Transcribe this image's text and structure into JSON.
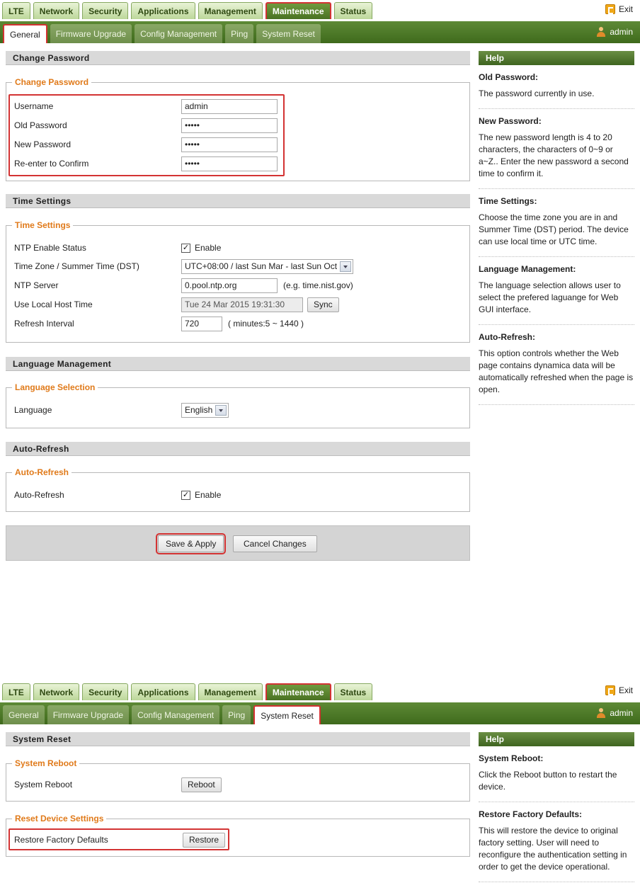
{
  "top_tabs": [
    "LTE",
    "Network",
    "Security",
    "Applications",
    "Management",
    "Maintenance",
    "Status"
  ],
  "exit_label": "Exit",
  "sub_tabs": [
    "General",
    "Firmware Upgrade",
    "Config Management",
    "Ping",
    "System Reset"
  ],
  "user_label": "admin",
  "general": {
    "change_password": {
      "header": "Change Password",
      "legend": "Change Password",
      "username_label": "Username",
      "username_value": "admin",
      "old_label": "Old Password",
      "old_value": "•••••",
      "new_label": "New Password",
      "new_value": "•••••",
      "confirm_label": "Re-enter to Confirm",
      "confirm_value": "•••••"
    },
    "time": {
      "header": "Time Settings",
      "legend": "Time Settings",
      "ntp_label": "NTP Enable Status",
      "ntp_enable": "Enable",
      "tz_label": "Time Zone / Summer Time (DST)",
      "tz_value": "UTC+08:00 / last Sun Mar - last Sun Oct",
      "server_label": "NTP Server",
      "server_value": "0.pool.ntp.org",
      "server_hint": "(e.g. time.nist.gov)",
      "local_label": "Use Local Host Time",
      "local_value": "Tue 24 Mar 2015 19:31:30",
      "sync_label": "Sync",
      "refresh_label": "Refresh Interval",
      "refresh_value": "720",
      "refresh_hint": "( minutes:5 ~ 1440 )"
    },
    "language": {
      "header": "Language Management",
      "legend": "Language Selection",
      "label": "Language",
      "value": "English"
    },
    "autorefresh": {
      "header": "Auto-Refresh",
      "legend": "Auto-Refresh",
      "label": "Auto-Refresh",
      "enable": "Enable"
    },
    "save_label": "Save & Apply",
    "cancel_label": "Cancel Changes",
    "help": {
      "title": "Help",
      "items": [
        {
          "title": "Old Password:",
          "text": "The password currently in use."
        },
        {
          "title": "New Password:",
          "text": "The new password length is 4 to 20 characters, the characters of 0~9 or a~Z.. Enter the new password a second time to confirm it."
        },
        {
          "title": "Time Settings:",
          "text": "Choose the time zone you are in and Summer Time (DST) period. The device can use local time or UTC time."
        },
        {
          "title": "Language Management:",
          "text": "The language selection allows user to select the prefered laguange for Web GUI interface."
        },
        {
          "title": "Auto-Refresh:",
          "text": "This option controls whether the Web page contains dynamica data will be automatically refreshed when the page is open."
        }
      ]
    }
  },
  "reset": {
    "header": "System Reset",
    "reboot_legend": "System Reboot",
    "reboot_label": "System Reboot",
    "reboot_button": "Reboot",
    "reset_legend": "Reset Device Settings",
    "restore_label": "Restore Factory Defaults",
    "restore_button": "Restore",
    "help": {
      "title": "Help",
      "items": [
        {
          "title": "System Reboot:",
          "text": "Click the Reboot button to restart the device."
        },
        {
          "title": "Restore Factory Defaults:",
          "text": "This will restore the device to original factory setting. User will need to reconfigure the authentication setting in order to get the device operational."
        }
      ]
    }
  }
}
